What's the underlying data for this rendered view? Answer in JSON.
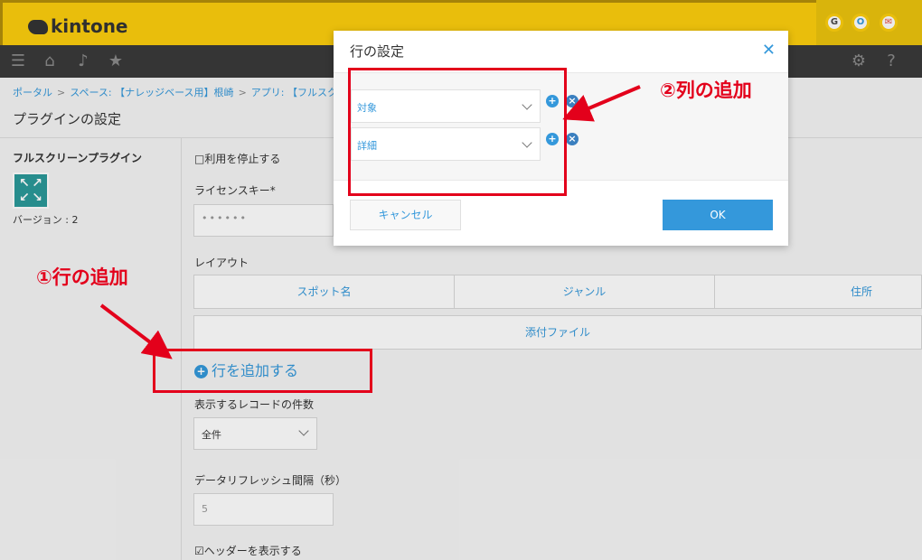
{
  "app": {
    "logo": "kintone"
  },
  "top_icons": [
    "G",
    "O",
    "✉"
  ],
  "breadcrumb": [
    "ポータル",
    "スペース: 【ナレッジベース用】根崎",
    "アプリ: 【フルスクリーン】"
  ],
  "page_title": "プラグインの設定",
  "plugin": {
    "name": "フルスクリーンプラグイン",
    "version": "バージョン : 2"
  },
  "form": {
    "stop_usage": "□利用を停止する",
    "license_label": "ライセンスキー*",
    "license_value": "••••••",
    "layout_label": "レイアウト",
    "layout_row1": [
      "スポット名",
      "ジャンル",
      "住所"
    ],
    "layout_row2": [
      "添付ファイル"
    ],
    "add_row": "行を追加する",
    "record_count_label": "表示するレコードの件数",
    "record_count_value": "全件",
    "refresh_label": "データリフレッシュ間隔（秒）",
    "refresh_value": "5",
    "show_header": "☑ヘッダーを表示する"
  },
  "dialog": {
    "title": "行の設定",
    "selects": [
      "対象",
      "詳細"
    ],
    "cancel": "キャンセル",
    "ok": "OK"
  },
  "annotations": {
    "add_row": "①行の追加",
    "add_column": "②列の追加"
  },
  "colors": {
    "accent": "#3498db",
    "header": "#fdcf0e",
    "annotation": "#e3001b"
  }
}
